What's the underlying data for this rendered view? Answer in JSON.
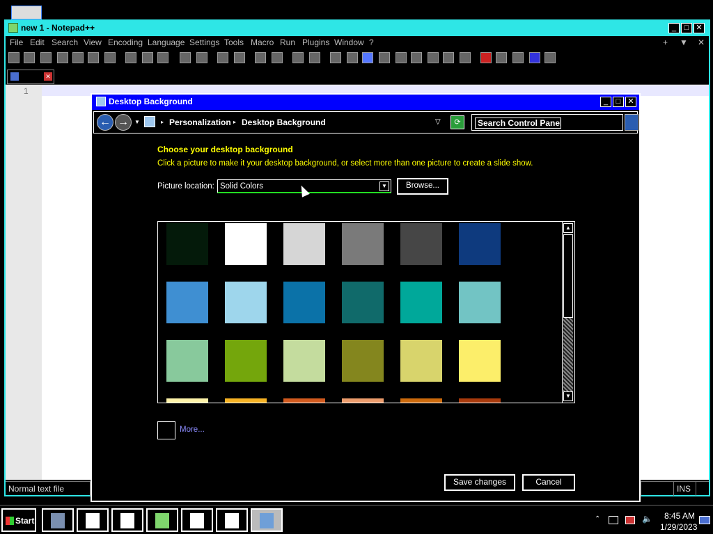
{
  "notepad": {
    "title": "new 1 - Notepad++",
    "menu": [
      "File",
      "Edit",
      "Search",
      "View",
      "Encoding",
      "Language",
      "Settings",
      "Tools",
      "Macro",
      "Run",
      "Plugins",
      "Window",
      "?"
    ],
    "menu_right": [
      "+",
      "▼",
      "✕"
    ],
    "line_number": "1",
    "status_left": "Normal text file",
    "status_right": "INS"
  },
  "dialog": {
    "title": "Desktop Background",
    "breadcrumb": [
      "Personalization",
      "Desktop Background"
    ],
    "search_value": "Search Control Panel",
    "heading": "Choose your desktop background",
    "subheading": "Click a picture to make it your desktop background, or select more than one picture to create a slide show.",
    "picture_location_label": "Picture location:",
    "picture_location_value": "Solid Colors",
    "browse_label": "Browse...",
    "more_label": "More...",
    "save_label": "Save changes",
    "cancel_label": "Cancel",
    "swatches": [
      [
        "#041a0a",
        "#ffffff",
        "#d6d6d6",
        "#7a7a7a",
        "#464646",
        "#0e3a7e"
      ],
      [
        "#3f8fd2",
        "#9ed6ec",
        "#0b72a8",
        "#106a6a",
        "#00a89a",
        "#72c4c4"
      ],
      [
        "#88c99c",
        "#74a60c",
        "#c4dc9e",
        "#84861e",
        "#d8d46c",
        "#fcee6a"
      ],
      [
        "#fdf2a8",
        "#f6b224",
        "#d25a1e",
        "#ec9c6c",
        "#cc6a0c",
        "#a83a0c"
      ]
    ]
  },
  "taskbar": {
    "start_label": "Start",
    "time": "8:45 AM",
    "date": "1/29/2023"
  }
}
